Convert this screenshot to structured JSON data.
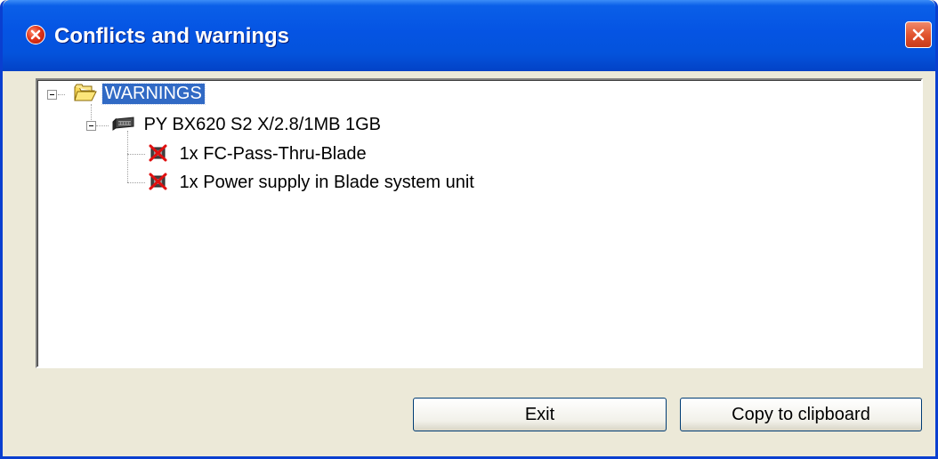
{
  "window": {
    "title": "Conflicts and warnings"
  },
  "tree": {
    "root": {
      "label": "WARNINGS",
      "icon": "folder-open-icon",
      "expanded": true,
      "selected": true
    },
    "device": {
      "label": "PY BX620 S2 X/2.8/1MB 1GB",
      "icon": "server-unit-icon",
      "expanded": true
    },
    "items": [
      {
        "label": "1x FC-Pass-Thru-Blade",
        "icon": "conflict-error-icon"
      },
      {
        "label": "1x Power supply in Blade system unit",
        "icon": "conflict-error-icon"
      }
    ]
  },
  "buttons": {
    "exit_label": "Exit",
    "copy_label": "Copy to clipboard"
  },
  "colors": {
    "titlebar": "#0554e3",
    "selection": "#316ac5",
    "dialog_background": "#ece9d8"
  }
}
